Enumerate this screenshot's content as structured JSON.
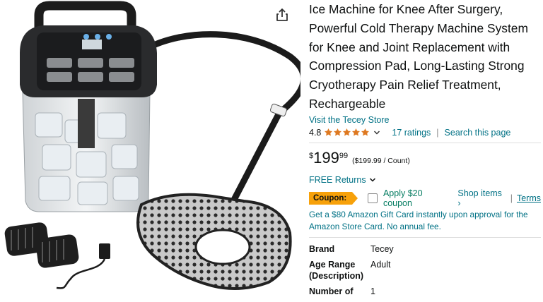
{
  "product": {
    "title": "Ice Machine for Knee After Surgery, Powerful Cold Therapy Machine System for Knee and Joint Replacement with Compression Pad, Long-Lasting Strong Cryotherapy Pain Relief Treatment, Rechargeable",
    "store_link": "Visit the Tecey Store"
  },
  "rating": {
    "value": "4.8",
    "stars": 4.8,
    "count_link": "17 ratings",
    "separator": "|",
    "search_link": "Search this page"
  },
  "price": {
    "currency": "$",
    "whole": "199",
    "fraction": "99",
    "per_unit": "($199.99 / Count)"
  },
  "returns": {
    "label": "FREE Returns"
  },
  "coupon": {
    "badge": "Coupon:",
    "apply_text": "Apply $20 coupon",
    "shop_items": "Shop items ›",
    "separator": "|",
    "terms": "Terms"
  },
  "promo": {
    "text": "Get a $80 Amazon Gift Card instantly upon approval for the Amazon Store Card. No annual fee."
  },
  "specs": [
    {
      "key": "Brand",
      "value": "Tecey"
    },
    {
      "key": "Age Range (Description)",
      "value": "Adult"
    },
    {
      "key": "Number of",
      "value": "1"
    }
  ],
  "icons": {
    "share": "share-icon",
    "star": "star-icon",
    "chevron": "chevron-down-icon"
  },
  "colors": {
    "link": "#007185",
    "star": "#de7921",
    "coupon_badge": "#f7a10a",
    "coupon_text": "#067d62"
  }
}
